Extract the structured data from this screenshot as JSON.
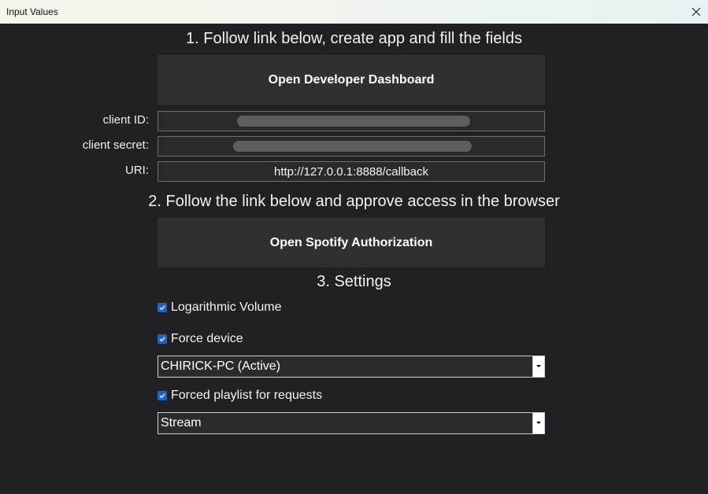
{
  "window": {
    "title": "Input Values",
    "close_icon": "close-icon"
  },
  "step1": {
    "heading": "1. Follow link below, create app and fill the fields",
    "dashboard_button": "Open Developer Dashboard"
  },
  "credentials": {
    "client_id_label": "client ID:",
    "client_id_value": "",
    "client_secret_label": "client secret:",
    "client_secret_value": "",
    "uri_label": "URI:",
    "uri_value": "http://127.0.0.1:8888/callback"
  },
  "step2": {
    "heading": "2. Follow the link below and approve access in the browser",
    "auth_button": "Open Spotify Authorization"
  },
  "step3": {
    "heading": "3. Settings",
    "log_volume_label": "Logarithmic Volume",
    "log_volume_checked": true,
    "force_device_label": "Force device",
    "force_device_checked": true,
    "device_selected": "CHIRICK-PC (Active)",
    "forced_playlist_label": "Forced playlist for requests",
    "forced_playlist_checked": true,
    "playlist_selected": "Stream"
  },
  "colors": {
    "background": "#212123",
    "button": "#303032",
    "checkbox_accent": "#1f63c6"
  }
}
